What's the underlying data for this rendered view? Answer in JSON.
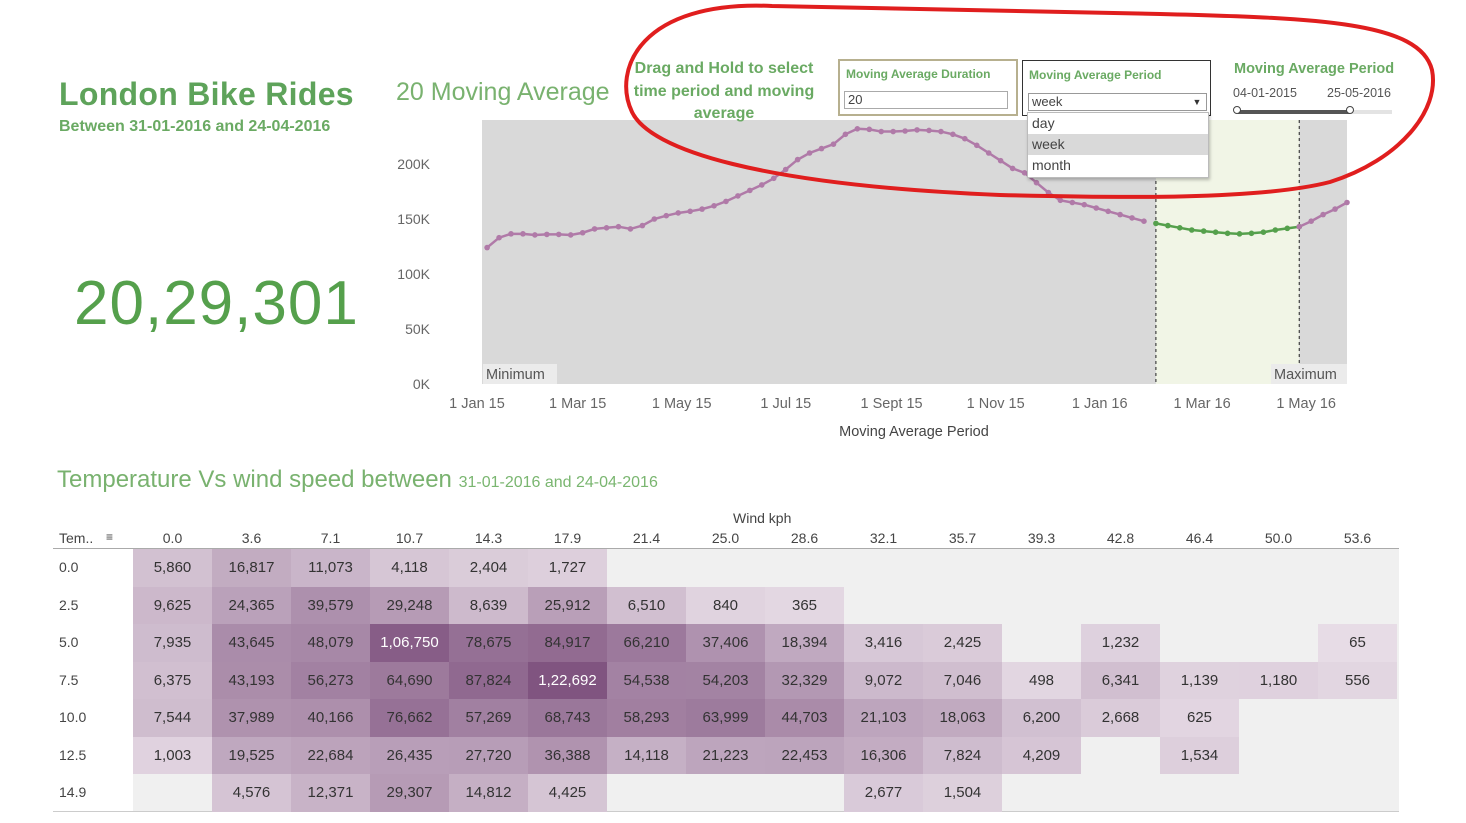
{
  "header": {
    "title": "London Bike Rides",
    "subtitle": "Between 31-01-2016 and 24-04-2016",
    "total_rides": "20,29,301"
  },
  "moving_average": {
    "title": "20  Moving Average",
    "hint": "Drag and Hold to select time period and moving average",
    "duration_label": "Moving Average Duration",
    "duration_value": "20",
    "period_label": "Moving Average Period",
    "period_selected": "week",
    "period_options": [
      "day",
      "week",
      "month"
    ],
    "slider_title": "Moving Average Period",
    "slider_start": "04-01-2015",
    "slider_end": "25-05-2016",
    "slider_start_fraction": 0.0,
    "slider_end_fraction": 1.0
  },
  "chart_data": {
    "type": "line",
    "xlabel": "Moving Average Period",
    "x_ticks": [
      "1 Jan 15",
      "1 Mar 15",
      "1 May 15",
      "1 Jul 15",
      "1 Sept 15",
      "1 Nov 15",
      "1 Jan 16",
      "1 Mar 16",
      "1 May 16"
    ],
    "y_ticks": [
      "0K",
      "50K",
      "100K",
      "150K",
      "200K"
    ],
    "ylim": [
      0,
      240000
    ],
    "band_labels": {
      "min": "Minimum",
      "max": "Maximum"
    },
    "selected_range": [
      "2016-01-31",
      "2016-04-24"
    ],
    "series": [
      {
        "color": "#b07aa8",
        "points": [
          [
            "2015-01-04",
            124000
          ],
          [
            "2015-01-11",
            133000
          ],
          [
            "2015-01-18",
            136500
          ],
          [
            "2015-01-25",
            136500
          ],
          [
            "2015-02-01",
            135500
          ],
          [
            "2015-02-08",
            136000
          ],
          [
            "2015-02-15",
            136000
          ],
          [
            "2015-02-22",
            135500
          ],
          [
            "2015-03-01",
            137500
          ],
          [
            "2015-03-08",
            141000
          ],
          [
            "2015-03-15",
            142000
          ],
          [
            "2015-03-22",
            143000
          ],
          [
            "2015-03-29",
            141000
          ],
          [
            "2015-04-05",
            144000
          ],
          [
            "2015-04-12",
            150000
          ],
          [
            "2015-04-19",
            153000
          ],
          [
            "2015-04-26",
            155500
          ],
          [
            "2015-05-03",
            157000
          ],
          [
            "2015-05-10",
            159000
          ],
          [
            "2015-05-17",
            162000
          ],
          [
            "2015-05-24",
            166000
          ],
          [
            "2015-05-31",
            171000
          ],
          [
            "2015-06-07",
            176000
          ],
          [
            "2015-06-14",
            181000
          ],
          [
            "2015-06-21",
            187000
          ],
          [
            "2015-06-28",
            195000
          ],
          [
            "2015-07-05",
            204000
          ],
          [
            "2015-07-12",
            210000
          ],
          [
            "2015-07-19",
            214000
          ],
          [
            "2015-07-26",
            218000
          ],
          [
            "2015-08-02",
            227000
          ],
          [
            "2015-08-09",
            232000
          ],
          [
            "2015-08-16",
            231500
          ],
          [
            "2015-08-23",
            229500
          ],
          [
            "2015-08-30",
            229500
          ],
          [
            "2015-09-06",
            230000
          ],
          [
            "2015-09-13",
            231000
          ],
          [
            "2015-09-20",
            230500
          ],
          [
            "2015-09-27",
            229500
          ],
          [
            "2015-10-04",
            227000
          ],
          [
            "2015-10-11",
            223000
          ],
          [
            "2015-10-18",
            217000
          ],
          [
            "2015-10-25",
            210000
          ],
          [
            "2015-11-01",
            203000
          ],
          [
            "2015-11-08",
            196000
          ],
          [
            "2015-11-15",
            192000
          ],
          [
            "2015-11-22",
            183000
          ],
          [
            "2015-11-29",
            174000
          ],
          [
            "2015-12-06",
            167000
          ],
          [
            "2015-12-13",
            165000
          ],
          [
            "2015-12-20",
            163000
          ],
          [
            "2015-12-27",
            160000
          ],
          [
            "2016-01-03",
            157000
          ],
          [
            "2016-01-10",
            154000
          ],
          [
            "2016-01-17",
            151000
          ],
          [
            "2016-01-24",
            148000
          ]
        ]
      },
      {
        "color": "#55a04c",
        "points": [
          [
            "2016-01-31",
            146000
          ],
          [
            "2016-02-07",
            144000
          ],
          [
            "2016-02-14",
            142000
          ],
          [
            "2016-02-21",
            140000
          ],
          [
            "2016-02-28",
            139000
          ],
          [
            "2016-03-06",
            138000
          ],
          [
            "2016-03-13",
            137000
          ],
          [
            "2016-03-20",
            136500
          ],
          [
            "2016-03-27",
            137000
          ],
          [
            "2016-04-03",
            138000
          ],
          [
            "2016-04-10",
            140000
          ],
          [
            "2016-04-17",
            141500
          ],
          [
            "2016-04-24",
            143000
          ]
        ]
      },
      {
        "color": "#b07aa8",
        "points": [
          [
            "2016-04-24",
            143000
          ],
          [
            "2016-05-01",
            148000
          ],
          [
            "2016-05-08",
            154000
          ],
          [
            "2016-05-15",
            159000
          ],
          [
            "2016-05-22",
            165000
          ]
        ]
      }
    ]
  },
  "heatmap": {
    "title": "Temperature Vs wind speed between ",
    "title_range": "31-01-2016 and 24-04-2016",
    "column_axis": "Wind kph",
    "row_axis": "Tem..",
    "columns": [
      "0.0",
      "3.6",
      "7.1",
      "10.7",
      "14.3",
      "17.9",
      "21.4",
      "25.0",
      "28.6",
      "32.1",
      "35.7",
      "39.3",
      "42.8",
      "46.4",
      "50.0",
      "53.6"
    ],
    "rows": [
      {
        "label": "0.0",
        "cells": [
          "5,860",
          "16,817",
          "11,073",
          "4,118",
          "2,404",
          "1,727",
          "",
          "",
          "",
          "",
          "",
          "",
          "",
          "",
          "",
          ""
        ]
      },
      {
        "label": "2.5",
        "cells": [
          "9,625",
          "24,365",
          "39,579",
          "29,248",
          "8,639",
          "25,912",
          "6,510",
          "840",
          "365",
          "",
          "",
          "",
          "",
          "",
          "",
          ""
        ]
      },
      {
        "label": "5.0",
        "cells": [
          "7,935",
          "43,645",
          "48,079",
          "1,06,750",
          "78,675",
          "84,917",
          "66,210",
          "37,406",
          "18,394",
          "3,416",
          "2,425",
          "",
          "1,232",
          "",
          "",
          "65"
        ]
      },
      {
        "label": "7.5",
        "cells": [
          "6,375",
          "43,193",
          "56,273",
          "64,690",
          "87,824",
          "1,22,692",
          "54,538",
          "54,203",
          "32,329",
          "9,072",
          "7,046",
          "498",
          "6,341",
          "1,139",
          "1,180",
          "556"
        ]
      },
      {
        "label": "10.0",
        "cells": [
          "7,544",
          "37,989",
          "40,166",
          "76,662",
          "57,269",
          "68,743",
          "58,293",
          "63,999",
          "44,703",
          "21,103",
          "18,063",
          "6,200",
          "2,668",
          "625",
          "",
          ""
        ]
      },
      {
        "label": "12.5",
        "cells": [
          "1,003",
          "19,525",
          "22,684",
          "26,435",
          "27,720",
          "36,388",
          "14,118",
          "21,223",
          "22,453",
          "16,306",
          "7,824",
          "4,209",
          "",
          "1,534",
          "",
          ""
        ]
      },
      {
        "label": "14.9",
        "cells": [
          "",
          "4,576",
          "12,371",
          "29,307",
          "14,812",
          "4,425",
          "",
          "",
          "",
          "2,677",
          "1,504",
          "",
          "",
          "",
          "",
          ""
        ]
      }
    ]
  }
}
